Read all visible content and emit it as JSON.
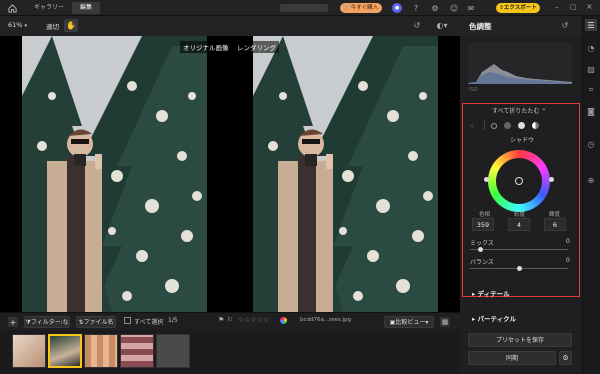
{
  "topbar": {
    "tabs": [
      "ギャラリー",
      "編集"
    ],
    "active_tab": "編集",
    "buy_label": "今すぐ購入",
    "export_label": "エクスポート"
  },
  "toolbar": {
    "zoom": "61%",
    "fit_label": "適切"
  },
  "canvas": {
    "label_original": "オリジナル画像",
    "label_rendered": "レンダリング"
  },
  "filmbar": {
    "filter_label": "フィルター:なし",
    "file_label": "ファイル名",
    "select_all_label": "すべて選択",
    "page_count": "1/5",
    "filename": "bcdd76a...rees.jpg",
    "compare_label": "比較ビュー"
  },
  "panel": {
    "title": "色調整",
    "histogram_label": "ISO -",
    "collapse_all": "すべて折りたたむ",
    "section_label": "シャドウ",
    "hue_label": "色相",
    "hue_value": "359",
    "sat_label": "彩度",
    "sat_value": "4",
    "lum_label": "輝度",
    "lum_value": "6",
    "mix_label": "ミックス",
    "mix_value": "0",
    "balance_label": "バランス",
    "balance_value": "0",
    "detail_label": "ディテール",
    "particle_label": "パーティクル",
    "save_preset_label": "プリセットを保存",
    "sync_label": "同期"
  },
  "colors": {
    "accent_yellow": "#f5c518",
    "highlight_red": "#e53935",
    "buy_orange": "#f4a261"
  }
}
